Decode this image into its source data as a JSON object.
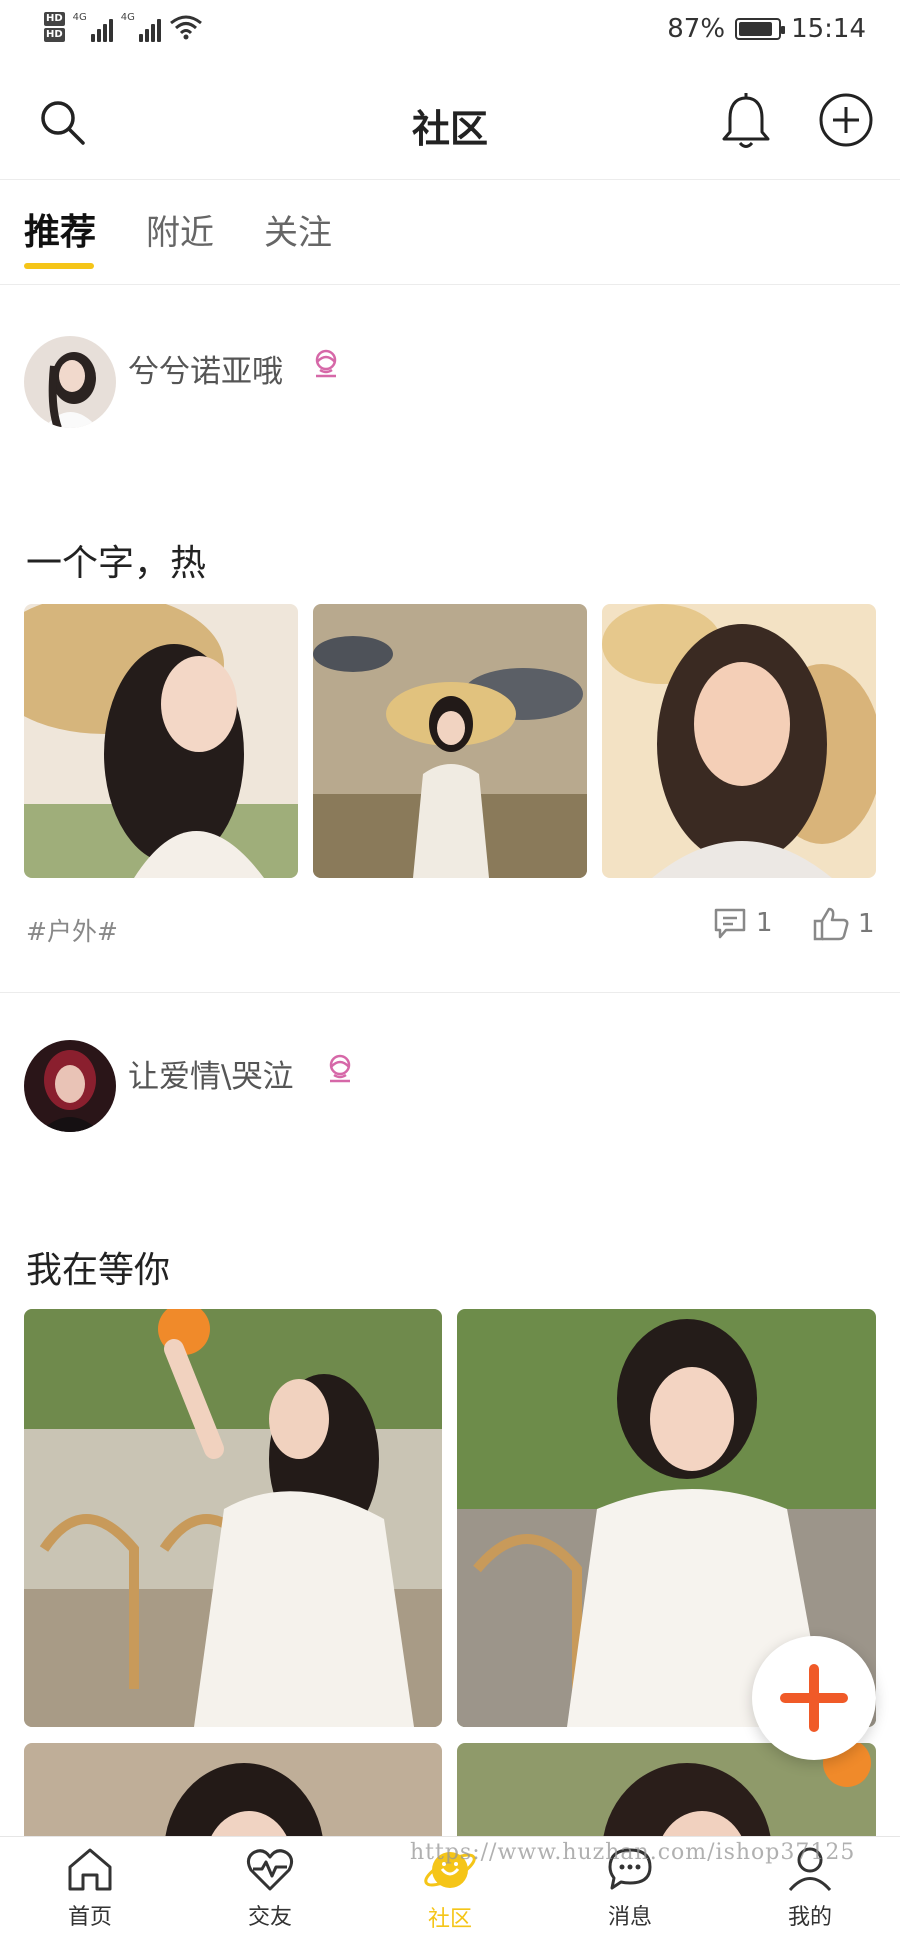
{
  "status_bar": {
    "hd1": "HD",
    "hd2": "HD",
    "net1": "4G",
    "net2": "4G",
    "battery_percent": "87%",
    "battery_level": 0.87,
    "time": "15:14"
  },
  "header": {
    "title": "社区",
    "icons": [
      "search-icon",
      "bell-icon",
      "add-circle-icon"
    ]
  },
  "tabs": [
    {
      "label": "推荐",
      "active": true
    },
    {
      "label": "附近",
      "active": false
    },
    {
      "label": "关注",
      "active": false
    }
  ],
  "posts": [
    {
      "username": "兮兮诺亚哦",
      "title": "一个字，热",
      "tag": "#户外#",
      "comments": "1",
      "likes": "1"
    },
    {
      "username": "让爱情\\哭泣",
      "title": "我在等你"
    }
  ],
  "bottom_nav": [
    {
      "label": "首页",
      "icon": "home-icon"
    },
    {
      "label": "交友",
      "icon": "heart-pulse-icon"
    },
    {
      "label": "社区",
      "icon": "planet-icon",
      "active": true
    },
    {
      "label": "消息",
      "icon": "chat-bubble-icon"
    },
    {
      "label": "我的",
      "icon": "person-icon"
    }
  ],
  "watermark": "https://www.huzhan.com/ishop37125",
  "colors": {
    "accent": "#f5c518",
    "fab_plus": "#f05a28",
    "badge": "#d668a8"
  }
}
